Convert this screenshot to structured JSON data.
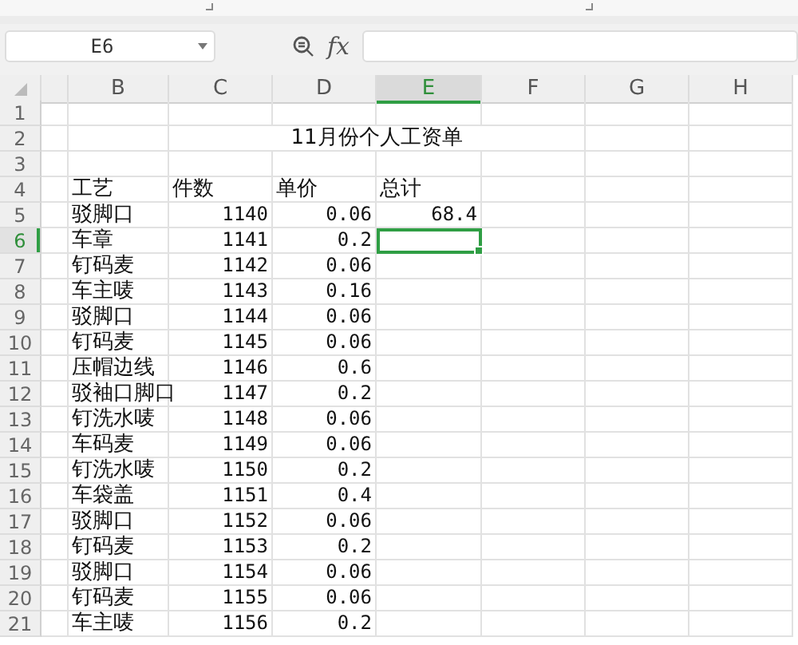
{
  "name_box": {
    "value": "E6"
  },
  "formula_bar": {
    "label": "fx"
  },
  "columns": [
    {
      "selected": false
    },
    {
      "label": "B",
      "selected": false
    },
    {
      "label": "C",
      "selected": false
    },
    {
      "label": "D",
      "selected": false
    },
    {
      "label": "E",
      "selected": true
    },
    {
      "label": "F",
      "selected": false
    },
    {
      "label": "G",
      "selected": false
    },
    {
      "label": "H",
      "selected": false
    }
  ],
  "rows": [
    {
      "number": "1",
      "selected": false,
      "kind": "blank"
    },
    {
      "number": "2",
      "selected": false,
      "kind": "title",
      "text": "11月份个人工资单"
    },
    {
      "number": "3",
      "selected": false,
      "kind": "blank"
    },
    {
      "number": "4",
      "selected": false,
      "kind": "header",
      "cells": {
        "B": "工艺",
        "C": "件数",
        "D": "单价",
        "E": "总计"
      }
    },
    {
      "number": "5",
      "selected": false,
      "kind": "data",
      "cells": {
        "B": "驳脚口",
        "C": "1140",
        "D": "0.06",
        "E": "68.4"
      }
    },
    {
      "number": "6",
      "selected": true,
      "kind": "data",
      "cells": {
        "B": "车章",
        "C": "1141",
        "D": "0.2"
      }
    },
    {
      "number": "7",
      "selected": false,
      "kind": "data",
      "cells": {
        "B": "钉码麦",
        "C": "1142",
        "D": "0.06"
      }
    },
    {
      "number": "8",
      "selected": false,
      "kind": "data",
      "cells": {
        "B": "车主唛",
        "C": "1143",
        "D": "0.16"
      }
    },
    {
      "number": "9",
      "selected": false,
      "kind": "data",
      "cells": {
        "B": "驳脚口",
        "C": "1144",
        "D": "0.06"
      }
    },
    {
      "number": "10",
      "selected": false,
      "kind": "data",
      "cells": {
        "B": "钉码麦",
        "C": "1145",
        "D": "0.06"
      }
    },
    {
      "number": "11",
      "selected": false,
      "kind": "data",
      "cells": {
        "B": "压帽边线",
        "C": "1146",
        "D": "0.6"
      }
    },
    {
      "number": "12",
      "selected": false,
      "kind": "data",
      "cells": {
        "B": "驳袖口脚口",
        "C": "1147",
        "D": "0.2"
      }
    },
    {
      "number": "13",
      "selected": false,
      "kind": "data",
      "cells": {
        "B": "钉洗水唛",
        "C": "1148",
        "D": "0.06"
      }
    },
    {
      "number": "14",
      "selected": false,
      "kind": "data",
      "cells": {
        "B": "车码麦",
        "C": "1149",
        "D": "0.06"
      }
    },
    {
      "number": "15",
      "selected": false,
      "kind": "data",
      "cells": {
        "B": "钉洗水唛",
        "C": "1150",
        "D": "0.2"
      }
    },
    {
      "number": "16",
      "selected": false,
      "kind": "data",
      "cells": {
        "B": "车袋盖",
        "C": "1151",
        "D": "0.4"
      }
    },
    {
      "number": "17",
      "selected": false,
      "kind": "data",
      "cells": {
        "B": "驳脚口",
        "C": "1152",
        "D": "0.06"
      }
    },
    {
      "number": "18",
      "selected": false,
      "kind": "data",
      "cells": {
        "B": "钉码麦",
        "C": "1153",
        "D": "0.2"
      }
    },
    {
      "number": "19",
      "selected": false,
      "kind": "data",
      "cells": {
        "B": "驳脚口",
        "C": "1154",
        "D": "0.06"
      }
    },
    {
      "number": "20",
      "selected": false,
      "kind": "data",
      "cells": {
        "B": "钉码麦",
        "C": "1155",
        "D": "0.06"
      }
    },
    {
      "number": "21",
      "selected": false,
      "kind": "data",
      "cells": {
        "B": "车主唛",
        "C": "1156",
        "D": "0.2"
      }
    }
  ]
}
